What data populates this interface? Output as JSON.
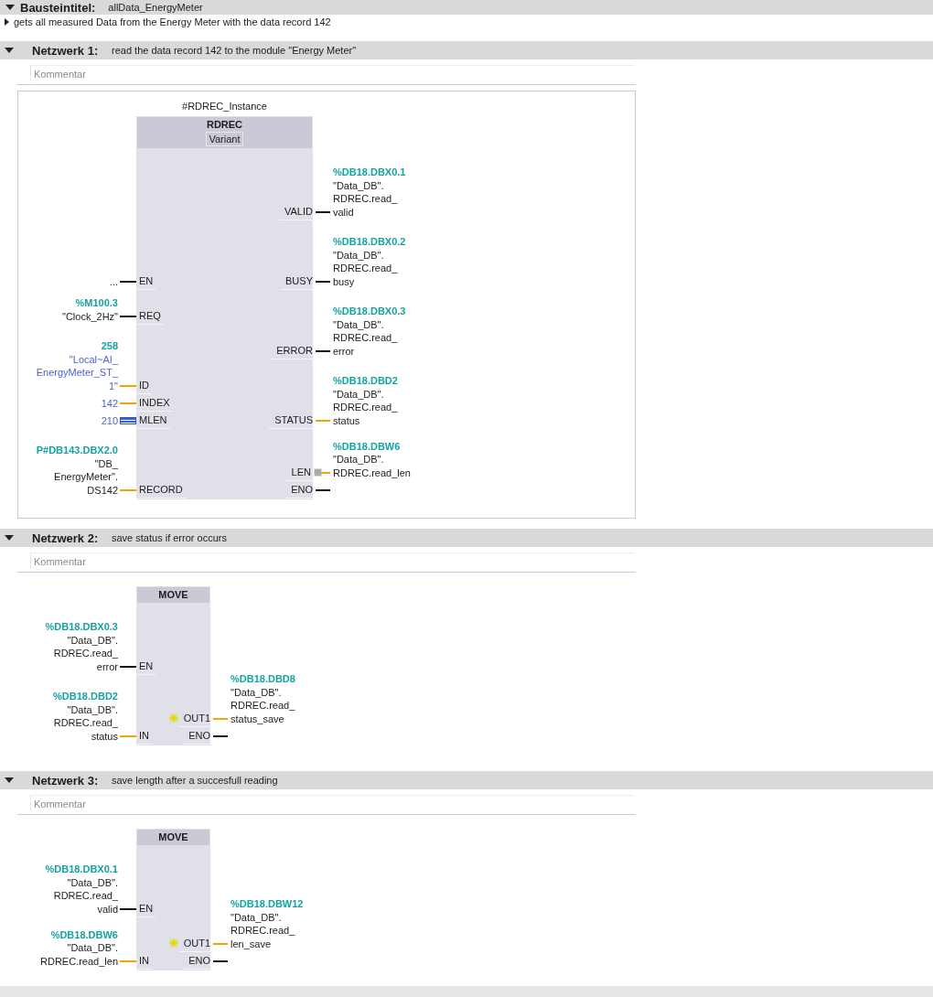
{
  "block_title": {
    "label": "Bausteintitel:",
    "value": "allData_EnergyMeter",
    "expanded": true
  },
  "block_comment": {
    "text": "gets all measured Data from the Energy Meter with the data record 142",
    "expanded": false
  },
  "networks": [
    {
      "label": "Netzwerk 1:",
      "title": "read the data record 142 to the module \"Energy Meter\"",
      "expanded": true,
      "selected": true,
      "comment_placeholder": "Kommentar",
      "instance": "#RDREC_Instance",
      "block": {
        "kind": "wide",
        "name": "RDREC",
        "variant": "Variant",
        "inputs": [
          {
            "pin": "EN",
            "kind": "bool",
            "operand": {
              "lines": [
                "..."
              ],
              "kind": "tag"
            }
          },
          {
            "pin": "REQ",
            "kind": "bool",
            "operand": {
              "address": "%M100.3",
              "lines": [
                "\"Clock_2Hz\""
              ],
              "kind": "tag"
            }
          },
          {
            "pin": "ID",
            "kind": "data",
            "operand": {
              "address": "258",
              "lines": [
                "\"Local~AI_",
                "EnergyMeter_ST_",
                "1\""
              ],
              "kind": "constant"
            }
          },
          {
            "pin": "INDEX",
            "kind": "data",
            "operand": {
              "lines": [
                "142"
              ],
              "kind": "constant"
            }
          },
          {
            "pin": "MLEN",
            "kind": "hatched",
            "operand": {
              "lines": [
                "210"
              ],
              "kind": "constant"
            }
          },
          {
            "pin": "RECORD",
            "kind": "data",
            "operand": {
              "address": "P#DB143.DBX2.0",
              "lines": [
                "\"DB_",
                "EnergyMeter\".",
                "DS142"
              ],
              "kind": "tag"
            }
          }
        ],
        "outputs": [
          {
            "pin": "VALID",
            "kind": "bool",
            "operand": {
              "address": "%DB18.DBX0.1",
              "lines": [
                "\"Data_DB\".",
                "RDREC.read_",
                "valid"
              ],
              "kind": "tag"
            }
          },
          {
            "pin": "BUSY",
            "kind": "bool",
            "operand": {
              "address": "%DB18.DBX0.2",
              "lines": [
                "\"Data_DB\".",
                "RDREC.read_",
                "busy"
              ],
              "kind": "tag"
            }
          },
          {
            "pin": "ERROR",
            "kind": "bool",
            "operand": {
              "address": "%DB18.DBX0.3",
              "lines": [
                "\"Data_DB\".",
                "RDREC.read_",
                "error"
              ],
              "kind": "tag"
            }
          },
          {
            "pin": "STATUS",
            "kind": "data",
            "operand": {
              "address": "%DB18.DBD2",
              "lines": [
                "\"Data_DB\".",
                "RDREC.read_",
                "status"
              ],
              "kind": "tag"
            }
          },
          {
            "pin": "LEN",
            "kind": "data-square",
            "operand": {
              "address": "%DB18.DBW6",
              "lines": [
                "\"Data_DB\".",
                "RDREC.read_len"
              ],
              "kind": "tag"
            }
          },
          {
            "pin": "ENO",
            "kind": "bool"
          }
        ]
      }
    },
    {
      "label": "Netzwerk 2:",
      "title": "save status if error occurs",
      "expanded": true,
      "selected": false,
      "comment_placeholder": "Kommentar",
      "block": {
        "kind": "narrow",
        "name": "MOVE",
        "inputs": [
          {
            "pin": "EN",
            "kind": "bool",
            "operand": {
              "address": "%DB18.DBX0.3",
              "lines": [
                "\"Data_DB\".",
                "RDREC.read_",
                "error"
              ],
              "kind": "tag"
            }
          },
          {
            "pin": "IN",
            "kind": "data",
            "operand": {
              "address": "%DB18.DBD2",
              "lines": [
                "\"Data_DB\".",
                "RDREC.read_",
                "status"
              ],
              "kind": "tag"
            }
          }
        ],
        "outputs": [
          {
            "pin": "OUT1",
            "kind": "data-star",
            "operand": {
              "address": "%DB18.DBD8",
              "lines": [
                "\"Data_DB\".",
                "RDREC.read_",
                "status_save"
              ],
              "kind": "tag"
            }
          },
          {
            "pin": "ENO",
            "kind": "bool"
          }
        ]
      }
    },
    {
      "label": "Netzwerk 3:",
      "title": "save length after a succesfull reading",
      "expanded": true,
      "selected": false,
      "comment_placeholder": "Kommentar",
      "block": {
        "kind": "narrow",
        "name": "MOVE",
        "inputs": [
          {
            "pin": "EN",
            "kind": "bool",
            "operand": {
              "address": "%DB18.DBX0.1",
              "lines": [
                "\"Data_DB\".",
                "RDREC.read_",
                "valid"
              ],
              "kind": "tag"
            }
          },
          {
            "pin": "IN",
            "kind": "data",
            "operand": {
              "address": "%DB18.DBW6",
              "lines": [
                "\"Data_DB\".",
                "RDREC.read_len"
              ],
              "kind": "tag"
            }
          }
        ],
        "outputs": [
          {
            "pin": "OUT1",
            "kind": "data-star",
            "operand": {
              "address": "%DB18.DBW12",
              "lines": [
                "\"Data_DB\".",
                "RDREC.read_",
                "len_save"
              ],
              "kind": "tag"
            }
          },
          {
            "pin": "ENO",
            "kind": "bool"
          }
        ]
      }
    }
  ]
}
